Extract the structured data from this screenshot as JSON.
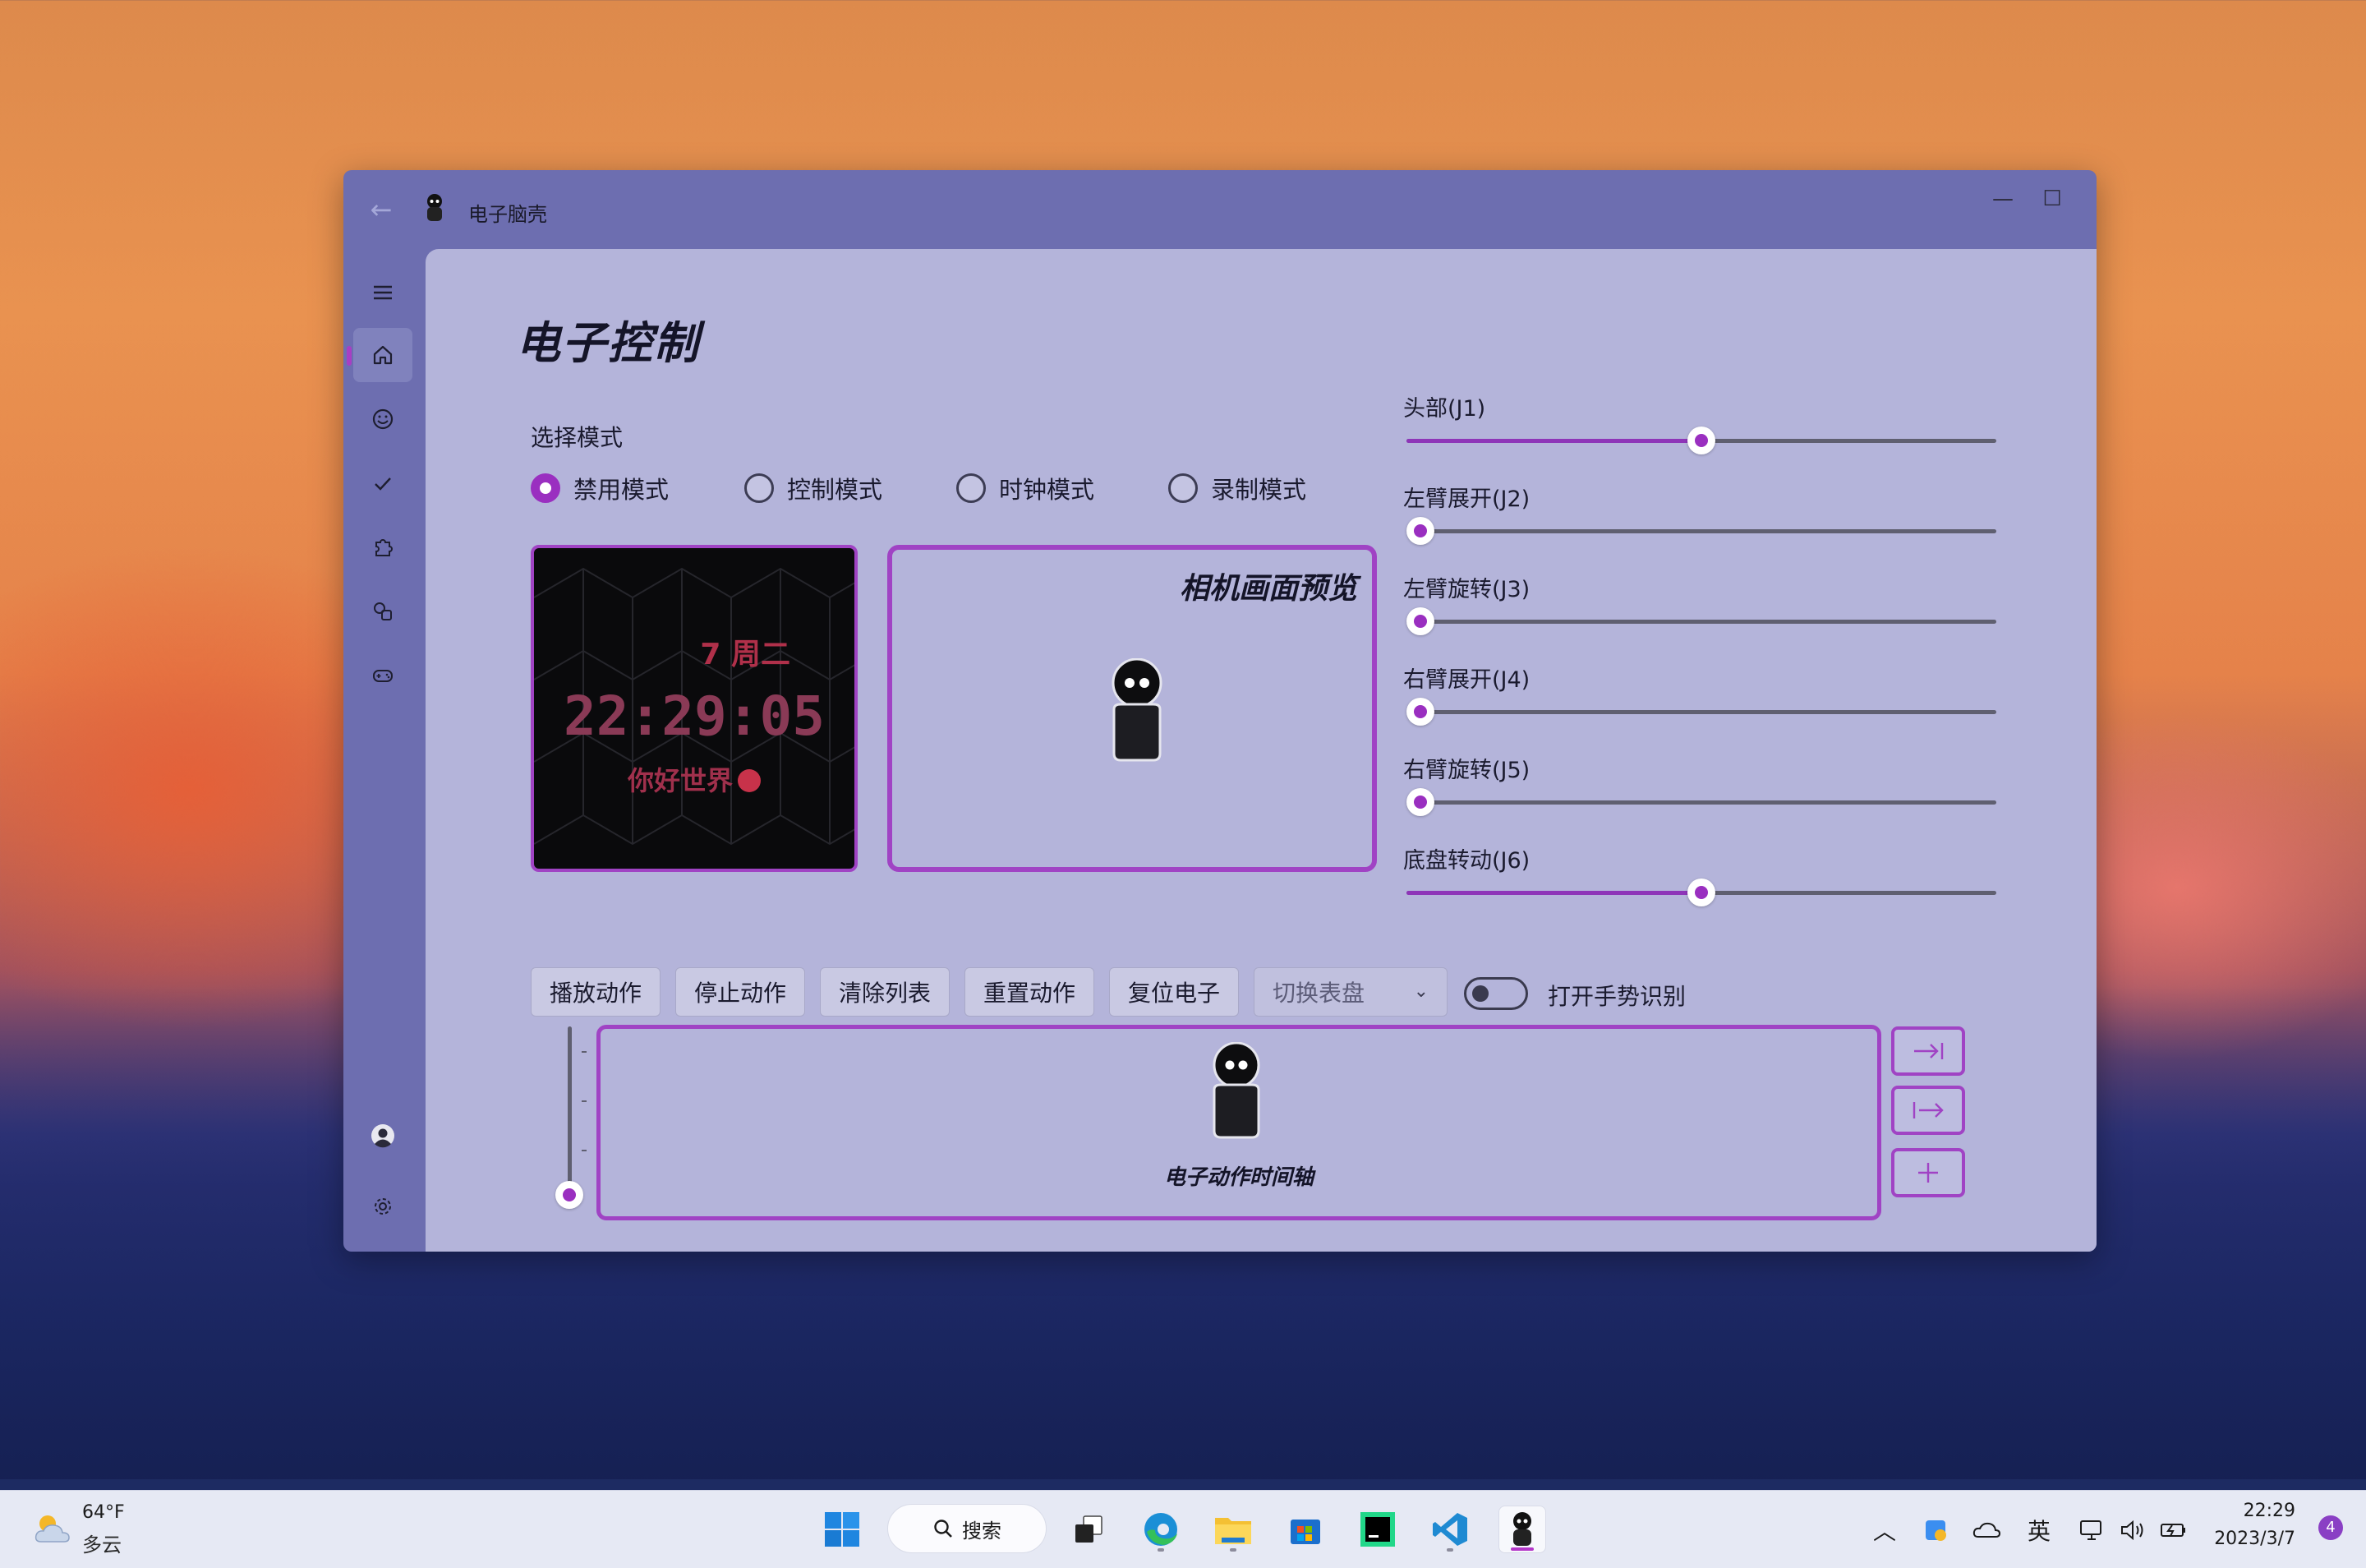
{
  "window": {
    "title": "电子脑壳",
    "controls": {
      "minimize": "—",
      "maximize": "☐",
      "close": "✕"
    }
  },
  "nav": {
    "items": [
      {
        "name": "home-icon",
        "active": true
      },
      {
        "name": "emoji-icon"
      },
      {
        "name": "check-icon"
      },
      {
        "name": "puzzle-icon"
      },
      {
        "name": "shapes-icon"
      },
      {
        "name": "gamepad-icon"
      }
    ],
    "footer": [
      "avatar-icon",
      "gear-icon"
    ]
  },
  "page": {
    "title": "电子控制",
    "mode_label": "选择模式",
    "modes": [
      {
        "label": "禁用模式",
        "checked": true
      },
      {
        "label": "控制模式",
        "checked": false
      },
      {
        "label": "时钟模式",
        "checked": false
      },
      {
        "label": "录制模式",
        "checked": false
      }
    ]
  },
  "clock": {
    "date": "7 周二",
    "time": "22:29:05",
    "message": "你好世界"
  },
  "preview": {
    "title": "相机画面预览"
  },
  "joints": [
    {
      "label": "头部(J1)",
      "value": 0.5
    },
    {
      "label": "左臂展开(J2)",
      "value": 0.0
    },
    {
      "label": "左臂旋转(J3)",
      "value": 0.0
    },
    {
      "label": "右臂展开(J4)",
      "value": 0.0
    },
    {
      "label": "右臂旋转(J5)",
      "value": 0.0
    },
    {
      "label": "底盘转动(J6)",
      "value": 0.5
    }
  ],
  "actions": {
    "buttons": [
      "播放动作",
      "停止动作",
      "清除列表",
      "重置动作",
      "复位电子"
    ],
    "dial_select": "切换表盘",
    "gesture_toggle": {
      "label": "打开手势识别",
      "on": false
    }
  },
  "timeline": {
    "label": "电子动作时间轴",
    "zoom_level": 0.0
  },
  "side_buttons": [
    "align-end-icon",
    "align-start-icon",
    "add-icon"
  ],
  "taskbar": {
    "weather": {
      "temp": "64°F",
      "condition": "多云"
    },
    "search": "搜索",
    "apps": [
      "windows-start-icon",
      "task-view-icon",
      "edge-icon",
      "file-explorer-icon",
      "store-icon",
      "pycharm-icon",
      "vscode-icon",
      "robot-app-icon"
    ],
    "tray": {
      "lang": "英"
    },
    "time": "22:29",
    "date": "2023/3/7",
    "notifications": "4"
  },
  "colors": {
    "accent": "#9a2fc0",
    "window_chrome": "#6d6eb0",
    "content_bg": "#b4b4da"
  }
}
